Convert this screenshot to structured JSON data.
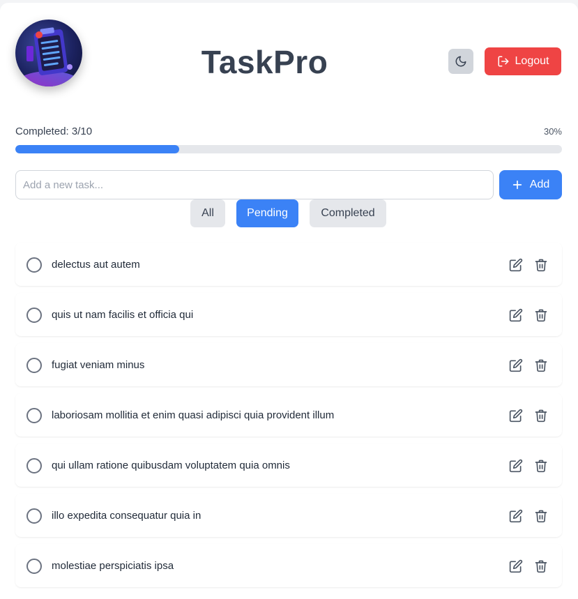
{
  "header": {
    "app_title": "TaskPro",
    "logout_label": "Logout",
    "theme_toggle_icon": "moon-icon",
    "logout_icon": "logout-icon"
  },
  "progress": {
    "label": "Completed: 3/10",
    "percent_text": "30%",
    "fraction": 0.3
  },
  "new_task": {
    "placeholder": "Add a new task...",
    "value": "",
    "add_label": "Add",
    "add_icon": "plus-icon"
  },
  "filters": [
    {
      "label": "All",
      "active": false
    },
    {
      "label": "Pending",
      "active": true
    },
    {
      "label": "Completed",
      "active": false
    }
  ],
  "tasks": [
    {
      "text": "delectus aut autem",
      "completed": false
    },
    {
      "text": "quis ut nam facilis et officia qui",
      "completed": false
    },
    {
      "text": "fugiat veniam minus",
      "completed": false
    },
    {
      "text": "laboriosam mollitia et enim quasi adipisci quia provident illum",
      "completed": false
    },
    {
      "text": "qui ullam ratione quibusdam voluptatem quia omnis",
      "completed": false
    },
    {
      "text": "illo expedita consequatur quia in",
      "completed": false
    },
    {
      "text": "molestiae perspiciatis ipsa",
      "completed": false
    }
  ],
  "colors": {
    "accent": "#3b82f6",
    "danger": "#ef4444",
    "muted": "#e5e7eb"
  }
}
